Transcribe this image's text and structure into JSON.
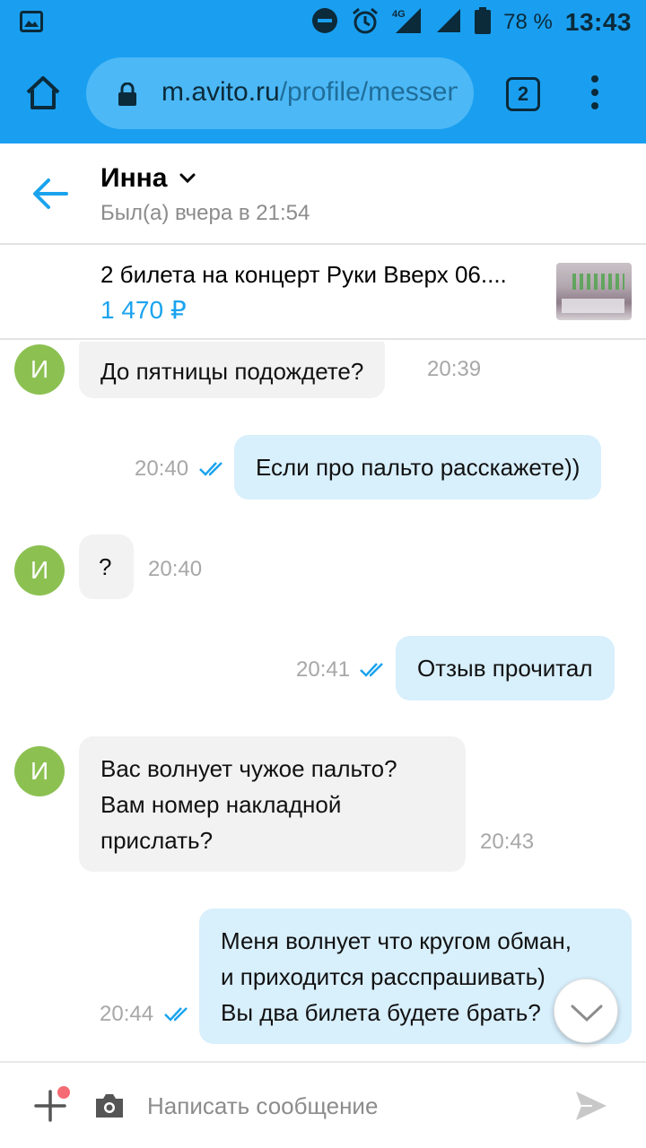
{
  "status_bar": {
    "battery": "78 %",
    "time": "13:43",
    "network": "4G",
    "icons": [
      "gallery-icon",
      "dnd-icon",
      "alarm-icon",
      "signal-4g-icon",
      "signal-icon",
      "battery-icon"
    ]
  },
  "browser": {
    "url_host": "m.avito.ru",
    "url_path": "/profile/messenger",
    "tab_count": "2"
  },
  "chat": {
    "contact_name": "Инна",
    "contact_status": "Был(а) вчера в 21:54",
    "avatar_letter": "И"
  },
  "item": {
    "title": "2 билета на концерт Руки Вверх 06....",
    "price": "1 470 ₽"
  },
  "messages": [
    {
      "direction": "in",
      "text": "До пятницы подождете?",
      "time": "20:39"
    },
    {
      "direction": "out",
      "text": "Если про пальто расскажете))",
      "time": "20:40",
      "read": true
    },
    {
      "direction": "in",
      "text": "?",
      "time": "20:40"
    },
    {
      "direction": "out",
      "text": "Отзыв прочитал",
      "time": "20:41",
      "read": true
    },
    {
      "direction": "in",
      "text_lines": [
        "Вас волнует чужое пальто?",
        "Вам номер накладной",
        "прислать?"
      ],
      "time": "20:43"
    },
    {
      "direction": "out",
      "text_lines": [
        "Меня волнует что кругом обман,",
        "и приходится расспрашивать)",
        "Вы два билета будете брать?"
      ],
      "time": "20:44",
      "read": true
    }
  ],
  "composer": {
    "placeholder": "Написать сообщение"
  },
  "colors": {
    "brand": "#1a9ff0",
    "price": "#1aa3ee",
    "avatar": "#8cc152",
    "bubble_in": "#f2f2f2",
    "bubble_out": "#d8effc",
    "read_check": "#1aa3ee"
  }
}
